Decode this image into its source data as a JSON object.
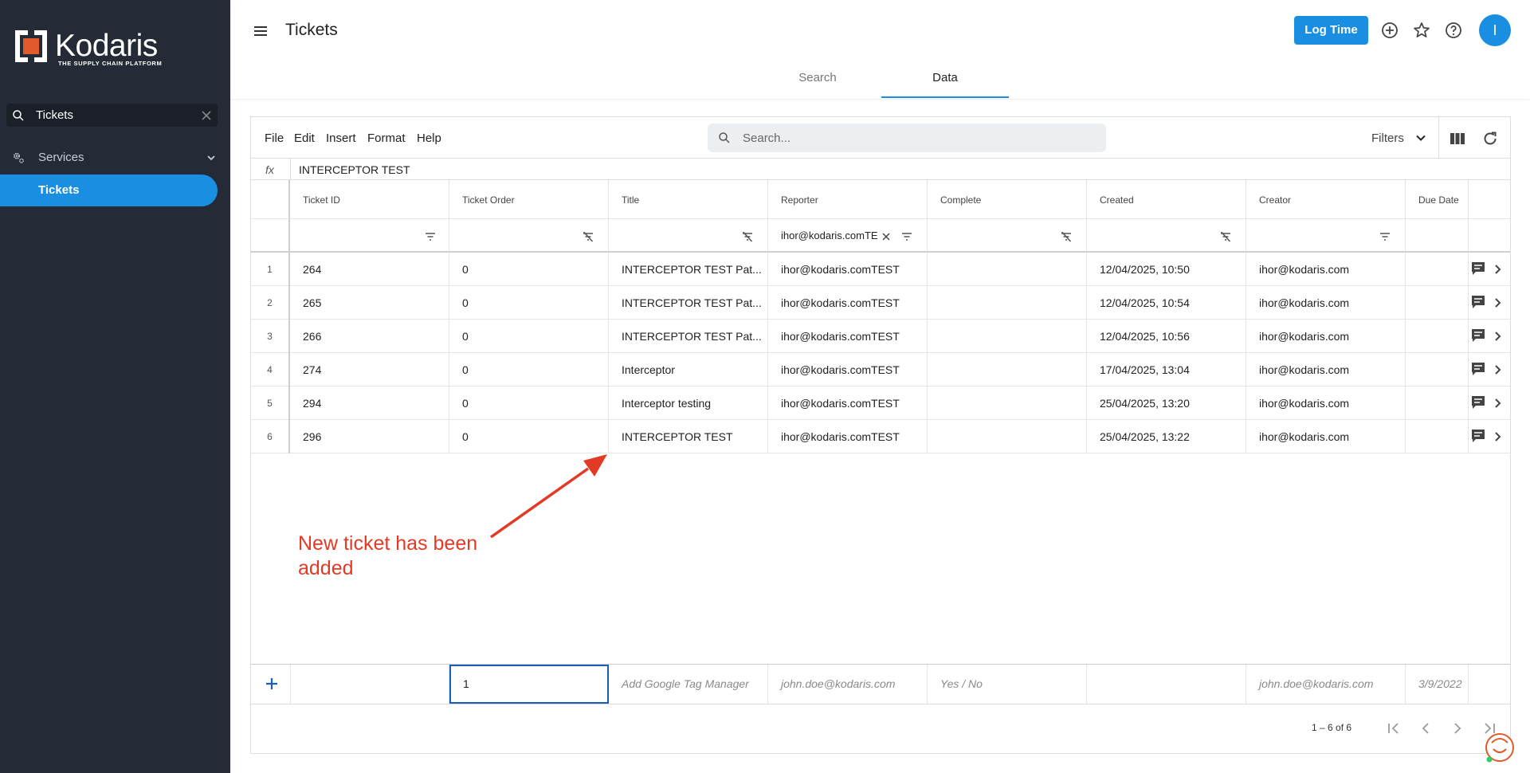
{
  "brand": {
    "name": "Kodaris",
    "tagline": "THE SUPPLY CHAIN PLATFORM",
    "accent_color": "#1a8ee0",
    "logo_color": "#e05a2b"
  },
  "sidebar": {
    "search": {
      "value": "Tickets",
      "icon": "search-icon",
      "clear_icon": "close-icon"
    },
    "groups": [
      {
        "label": "Services",
        "icon": "gears-icon",
        "expand_icon": "chevron-down-icon",
        "items": [
          {
            "label": "Tickets",
            "active": true
          }
        ]
      }
    ]
  },
  "header": {
    "title": "Tickets",
    "log_time_label": "Log Time",
    "avatar_initial": "I",
    "icons": [
      "menu-icon",
      "add-circle-icon",
      "star-icon",
      "help-icon"
    ],
    "tabs": [
      {
        "label": "Search",
        "active": false
      },
      {
        "label": "Data",
        "active": true
      }
    ]
  },
  "toolbar": {
    "menus": [
      "File",
      "Edit",
      "Insert",
      "Format",
      "Help"
    ],
    "search_placeholder": "Search...",
    "filters_label": "Filters",
    "icons": [
      "columns-icon",
      "refresh-icon"
    ]
  },
  "formula_bar": {
    "label": "fx",
    "value": "INTERCEPTOR TEST"
  },
  "grid": {
    "columns": [
      "Ticket ID",
      "Ticket Order",
      "Title",
      "Reporter",
      "Complete",
      "Created",
      "Creator",
      "Due Date"
    ],
    "filters": [
      "",
      "",
      "",
      "ihor@kodaris.comTEST",
      "",
      "",
      "",
      ""
    ],
    "rows": [
      {
        "num": "1",
        "cells": [
          "264",
          "0",
          "INTERCEPTOR TEST Pat...",
          "ihor@kodaris.comTEST",
          "",
          "12/04/2025, 10:50",
          "ihor@kodaris.com",
          ""
        ]
      },
      {
        "num": "2",
        "cells": [
          "265",
          "0",
          "INTERCEPTOR TEST Pat...",
          "ihor@kodaris.comTEST",
          "",
          "12/04/2025, 10:54",
          "ihor@kodaris.com",
          ""
        ]
      },
      {
        "num": "3",
        "cells": [
          "266",
          "0",
          "INTERCEPTOR TEST Pat...",
          "ihor@kodaris.comTEST",
          "",
          "12/04/2025, 10:56",
          "ihor@kodaris.com",
          ""
        ]
      },
      {
        "num": "4",
        "cells": [
          "274",
          "0",
          "Interceptor",
          "ihor@kodaris.comTEST",
          "",
          "17/04/2025, 13:04",
          "ihor@kodaris.com",
          ""
        ]
      },
      {
        "num": "5",
        "cells": [
          "294",
          "0",
          "Interceptor testing",
          "ihor@kodaris.comTEST",
          "",
          "25/04/2025, 13:20",
          "ihor@kodaris.com",
          ""
        ]
      },
      {
        "num": "6",
        "cells": [
          "296",
          "0",
          "INTERCEPTOR TEST",
          "ihor@kodaris.comTEST",
          "",
          "25/04/2025, 13:22",
          "ihor@kodaris.com",
          ""
        ]
      }
    ],
    "new_row": {
      "values": [
        "",
        "1",
        "",
        "",
        "",
        "",
        "",
        ""
      ],
      "placeholders": [
        "",
        "",
        "Add Google Tag Manager",
        "john.doe@kodaris.com",
        "Yes / No",
        "",
        "john.doe@kodaris.com",
        "3/9/2022"
      ]
    }
  },
  "annotation": {
    "text_line1": "New ticket has been",
    "text_line2": "added",
    "color": "#e23a24"
  },
  "pagination": {
    "range": "1 – 6 of 6"
  }
}
